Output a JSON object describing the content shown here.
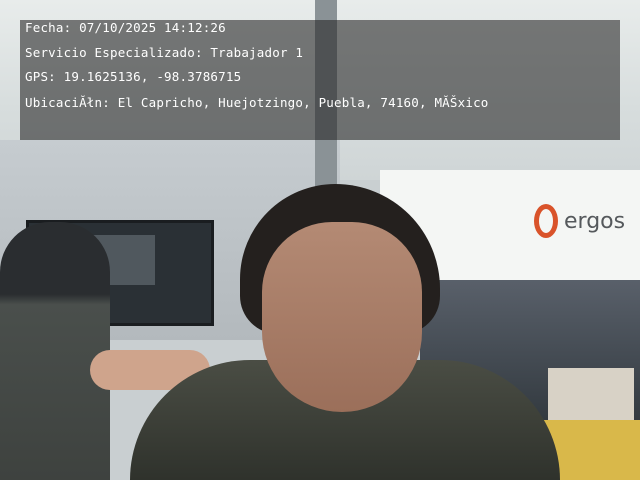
{
  "overlay": {
    "fecha": "Fecha: 07/10/2025 14:12:26",
    "servicio": "Servicio Especializado: Trabajador 1",
    "gps": "GPS: 19.1625136, -98.3786715",
    "ubicacion": "UbicaciĂłn: El Capricho, Huejotzingo, Puebla, 74160, MĂŠxico"
  },
  "background": {
    "logo_text": "ergos",
    "logo_color": "#d9532a"
  }
}
